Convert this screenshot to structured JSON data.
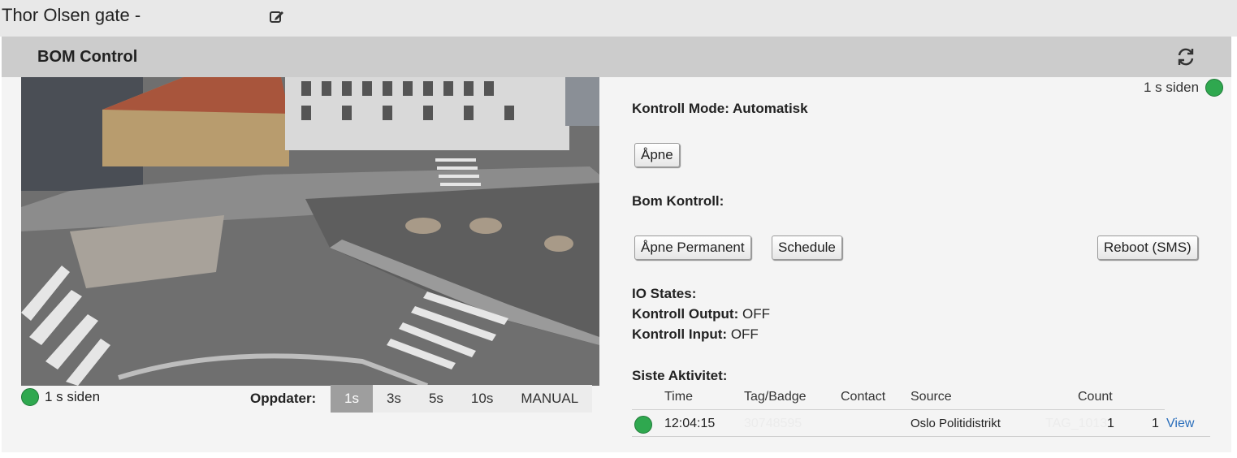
{
  "header": {
    "title": "Thor Olsen gate -",
    "edit_icon": "edit-icon"
  },
  "panel": {
    "title": "BOM Control",
    "refresh_icon": "refresh-icon"
  },
  "camera": {
    "status_text": "1 s siden",
    "status_color": "#2fa84f",
    "update_label": "Oppdater:",
    "update_options": [
      "1s",
      "3s",
      "5s",
      "10s",
      "MANUAL"
    ],
    "update_selected": "1s"
  },
  "status": {
    "text": "1 s siden",
    "color": "#2fa84f"
  },
  "control": {
    "mode_label": "Kontroll Mode: Automatisk",
    "open_button": "Åpne",
    "bom_label": "Bom Kontroll:",
    "open_permanent_button": "Åpne Permanent",
    "schedule_button": "Schedule",
    "reboot_button": "Reboot (SMS)"
  },
  "io": {
    "title": "IO States:",
    "output_label": "Kontroll Output:",
    "output_value": "OFF",
    "input_label": "Kontroll Input:",
    "input_value": "OFF"
  },
  "activity": {
    "title": "Siste Aktivitet:",
    "columns": [
      "Time",
      "Tag/Badge",
      "Contact",
      "Source",
      "Count"
    ],
    "rows": [
      {
        "status_color": "#2fa84f",
        "time": "12:04:15",
        "tag": "30748595",
        "contact": "",
        "source": "Oslo Politidistrikt",
        "faded_tag": "TAG_1013",
        "count_a": "1",
        "count_b": "1",
        "action": "View"
      }
    ]
  }
}
